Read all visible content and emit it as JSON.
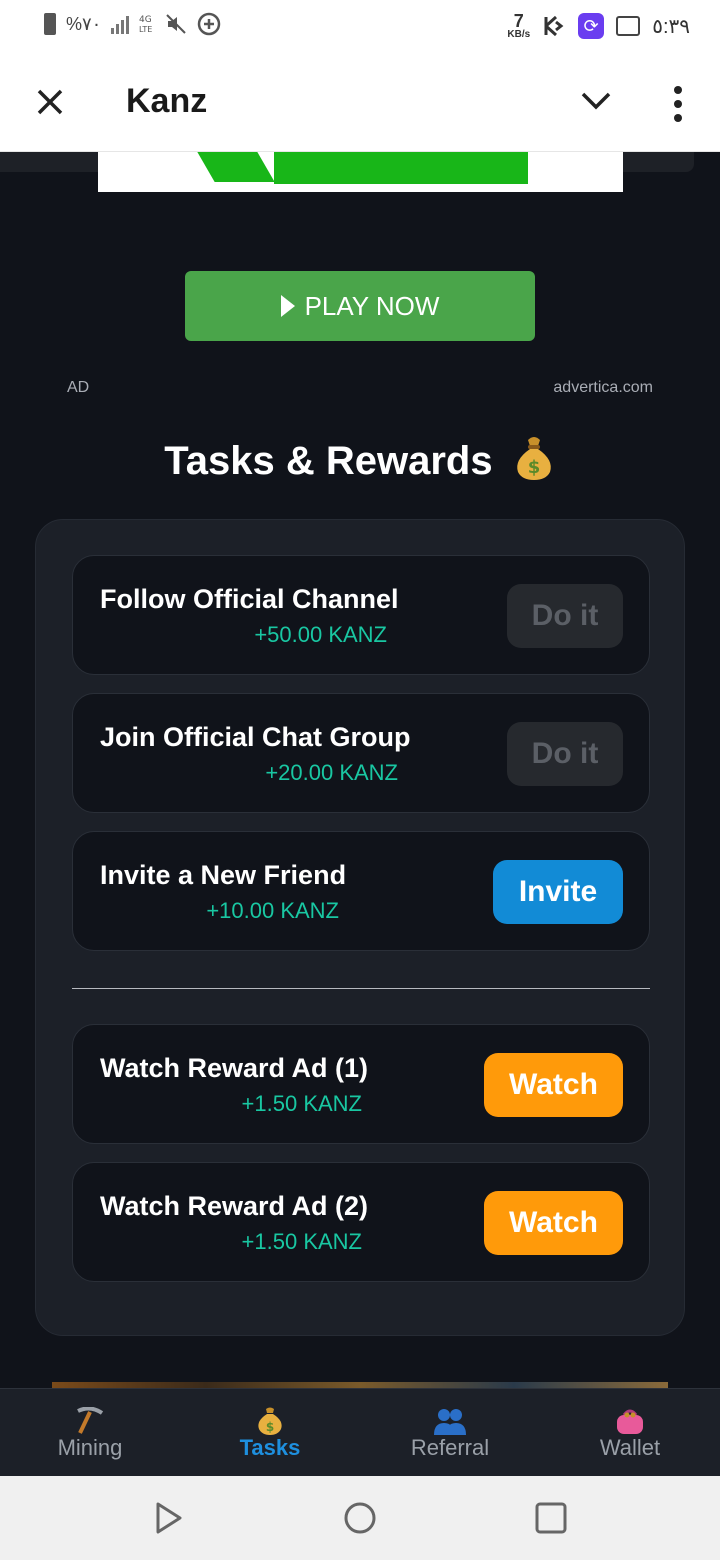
{
  "status_bar": {
    "battery_text": "%٧٠",
    "network_label": "4G LTE",
    "speed_value": "7",
    "speed_unit": "KB/s",
    "time": "٥:٣٩"
  },
  "app_bar": {
    "title": "Kanz"
  },
  "ad": {
    "play_label": "PLAY NOW",
    "ad_label": "AD",
    "domain": "advertica.com"
  },
  "section": {
    "title": "Tasks & Rewards"
  },
  "tasks": [
    {
      "name": "Follow Official Channel",
      "reward": "+50.00 KANZ",
      "button": "Do it"
    },
    {
      "name": "Join Official Chat Group",
      "reward": "+20.00 KANZ",
      "button": "Do it"
    },
    {
      "name": "Invite a New Friend",
      "reward": "+10.00 KANZ",
      "button": "Invite"
    },
    {
      "name": "Watch Reward Ad (1)",
      "reward": "+1.50 KANZ",
      "button": "Watch"
    },
    {
      "name": "Watch Reward Ad (2)",
      "reward": "+1.50 KANZ",
      "button": "Watch"
    }
  ],
  "bottom_nav": [
    {
      "label": "Mining",
      "icon": "pickaxe-icon"
    },
    {
      "label": "Tasks",
      "icon": "money-bag-icon",
      "active": true
    },
    {
      "label": "Referral",
      "icon": "people-icon"
    },
    {
      "label": "Wallet",
      "icon": "purse-icon"
    }
  ],
  "colors": {
    "reward": "#19c7a2",
    "invite_button": "#128bd6",
    "watch_button": "#ff9a0a",
    "active_tab": "#1e8fde",
    "play_button": "#4aa54a"
  }
}
